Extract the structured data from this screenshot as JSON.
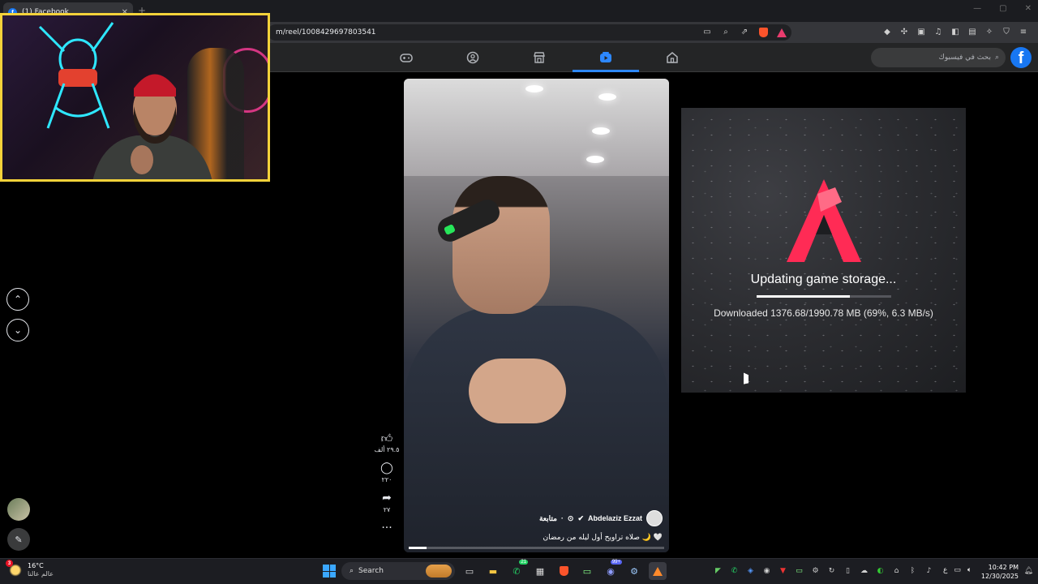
{
  "browser": {
    "tab_title": "(1) Facebook",
    "tab_favicon": "f",
    "new_tab": "+",
    "url": "m/reel/1008429697803541"
  },
  "facebook": {
    "logo": "f",
    "search_placeholder": "بحث في فيسبوك",
    "nav": [
      "gaming-icon",
      "groups-icon",
      "marketplace-icon",
      "video-icon",
      "home-icon"
    ],
    "active_nav": "video-icon"
  },
  "reel": {
    "author": "Abdelaziz Ezzat",
    "follow_label": "متابعة",
    "caption": "صلاه تراويح أول ليله من رمضان 🌙 🤍",
    "likes": "٢٩.٥ ألف",
    "comments": "٢٢٠",
    "shares": "٢٧",
    "more": "···",
    "progress": 0.07
  },
  "updater": {
    "title": "Updating game storage...",
    "status": "Downloaded 1376.68/1990.78 MB (69%, 6.3 MB/s)",
    "progress": 0.69,
    "accent_color": "#ff2b55"
  },
  "taskbar": {
    "weather_temp": "16°C",
    "weather_sub": "عالم عالنا",
    "weather_badge": "3",
    "search_label": "Search",
    "discord_badge": "99+",
    "messenger_badge": "21",
    "lang": "ع",
    "time": "10:42 PM",
    "date": "12/30/2025"
  }
}
